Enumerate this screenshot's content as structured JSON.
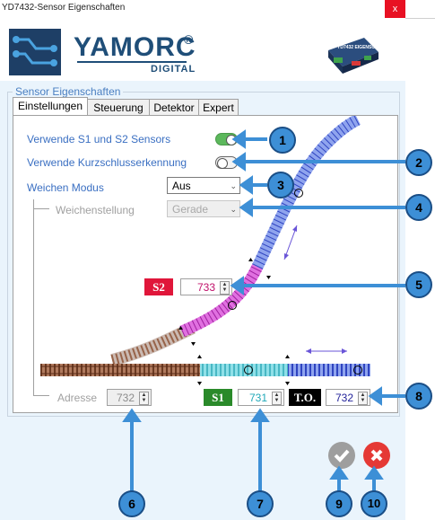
{
  "window": {
    "title": "YD7432-Sensor Eigenschaften",
    "close_symbol": "x"
  },
  "brand": {
    "name": "YAMORC",
    "registered": "®",
    "sub": "DIGITAL",
    "device_label": "YD7432 EIGENSCHAFTEN"
  },
  "group": {
    "legend": "Sensor Eigenschaften"
  },
  "tabs": [
    {
      "label": "Einstellungen",
      "active": true
    },
    {
      "label": "Steuerung",
      "active": false
    },
    {
      "label": "Detektor",
      "active": false
    },
    {
      "label": "Expert",
      "active": false
    }
  ],
  "settings": {
    "use_sensors_label": "Verwende S1 und S2 Sensors",
    "use_sensors_on": true,
    "short_detect_label": "Verwende Kurzschlusserkennung",
    "short_detect_on": false,
    "turnout_mode_label": "Weichen Modus",
    "turnout_mode_value": "Aus",
    "position_label": "Weichenstellung",
    "position_value": "Gerade"
  },
  "sensors": {
    "s2_tag": "S2",
    "s2_value": "733",
    "s1_tag": "S1",
    "s1_value": "731",
    "to_tag": "T.O.",
    "to_value": "732",
    "address_label": "Adresse",
    "address_value": "732"
  },
  "callouts": [
    "1",
    "2",
    "3",
    "4",
    "5",
    "6",
    "7",
    "8",
    "9",
    "10"
  ],
  "colors": {
    "accent": "#3d8fd6",
    "s2": "#e0163a",
    "s1": "#2a8a2a",
    "to": "#000000",
    "ok": "#9e9e9e",
    "cancel": "#e53935"
  }
}
